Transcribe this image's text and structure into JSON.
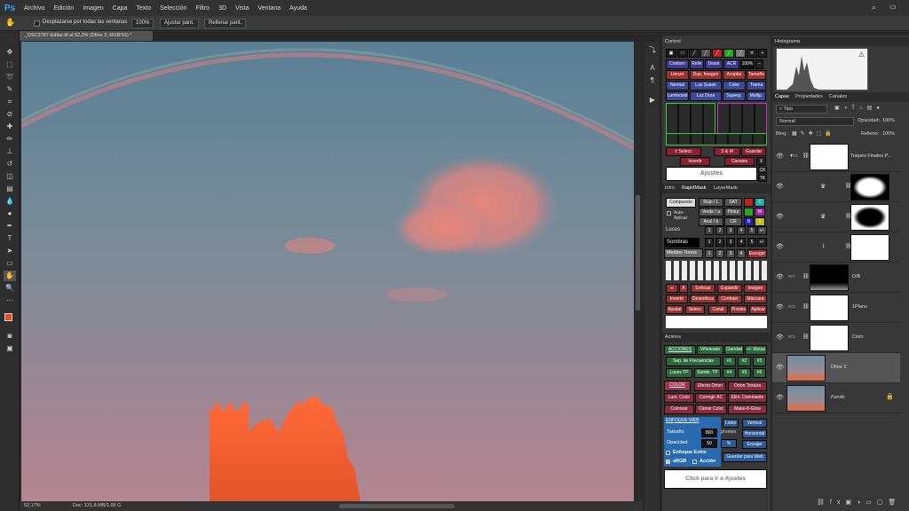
{
  "app": {
    "logo": "Ps"
  },
  "menu": [
    "Archivo",
    "Edición",
    "Imagen",
    "Capa",
    "Texto",
    "Selección",
    "Filtro",
    "3D",
    "Vista",
    "Ventana",
    "Ayuda"
  ],
  "options": {
    "scroll_all": "Desplazarse por todas las ventanas",
    "zoom": "100%",
    "fit": "Ajustar pant.",
    "fill": "Rellenar pant."
  },
  "document": {
    "tab": "_DSC3787-Editar.tif al 52,2% (Dfine 2, RGB/16) *",
    "zoom": "52,17%",
    "doc_info": "Doc: 131,8 MB/1,09 G"
  },
  "control_panel": {
    "title": "Control",
    "row1": [
      "Contorn",
      "Relle",
      "Desnt",
      "ACR",
      "100%"
    ],
    "row2": [
      "Lienzo",
      "Dup. Imagen",
      "Acoplar",
      "Tamaño"
    ],
    "row3": [
      "Normal",
      "Luz Suave",
      "Color",
      "Trama"
    ],
    "row4": [
      "Luminosid",
      "Luz Dura",
      "Superp.",
      "Multip."
    ],
    "row_sel": [
      "± Selecc",
      "S & M",
      "Guardar"
    ],
    "row_inv": [
      "Invertir",
      "Canales",
      "X"
    ],
    "ajustes": "Ajustes",
    "ck": "CK",
    "tk": "TK"
  },
  "rapidmask": {
    "tabs": [
      "Intro",
      "RapidMask",
      "LayerMask"
    ],
    "compuesto": "Compuesto",
    "auto_aplicar": "Auto-Aplicar",
    "col_a": [
      "Rojo / L",
      "Verde / a",
      "Azul / b"
    ],
    "col_b": [
      "SAT",
      "Pintur",
      "CR"
    ],
    "rgby": [
      "C",
      "M",
      "B",
      "Y"
    ],
    "luces": "Luces",
    "sombras": "Sombras",
    "medios": "Medios Tonos",
    "escoger": "Escoger",
    "nums": [
      "1",
      "2",
      "3",
      "4",
      "5",
      "+/-"
    ],
    "actions1": [
      "A",
      "Enfocar",
      "Expandir",
      "Imagen"
    ],
    "actions2": [
      "Invertir",
      "Desenfoca",
      "Contraer",
      "Máscara"
    ],
    "actions3": [
      "Ajustar",
      "Selecc",
      "Canal",
      "Pixeles",
      "Aplicar"
    ]
  },
  "actions": {
    "title": "Actions",
    "acciones": "ACCIONES",
    "a1": [
      "Viñeteado",
      "Claridad",
      "+/- Motas"
    ],
    "a2": [
      "Sep. de Frecuencias",
      "#1",
      "#2",
      "#3"
    ],
    "a3": [
      "Luces TP",
      "Sombr. TP",
      "#4",
      "#5",
      "#6"
    ],
    "color": "COLOR",
    "c1": [
      "Efecto Orton",
      "Orton Textura"
    ],
    "c2": [
      "Lum. Color",
      "Corregir AC",
      "Elim. Dominante"
    ],
    "c3": [
      "Colorear",
      "Clonar Color",
      "Make-It-Glow"
    ],
    "web_title": "ENFOQUE WEB",
    "lotes": "Lotes",
    "vertical": "Vertical",
    "horizontal": "Horizontal",
    "encajar": "Encajar",
    "tamano": "Tamaño",
    "tamano_val": "800",
    "pixeles": "píxeles",
    "opacidad": "Opacidad",
    "opacidad_val": "50",
    "pct": "%",
    "enfoque_extra": "Enfoque Extra",
    "srgb": "sRGB",
    "accion": "Acción",
    "guardar_web": "Guardar para Web",
    "click_ajustes": "Click para ir a Ajustes"
  },
  "histogram": {
    "title": "Histograma"
  },
  "layers": {
    "tabs": [
      "Capas",
      "Propiedades",
      "Canales"
    ],
    "filter": "Tipo",
    "blend": "Normal",
    "opacity_label": "Opacidad:",
    "opacity": "100%",
    "lock_label": "Bloq.:",
    "fill_label": "Relleno:",
    "fill": "100%",
    "items": [
      {
        "name": "Toques Finales P..."
      },
      {
        "name": ""
      },
      {
        "name": ""
      },
      {
        "name": ""
      },
      {
        "name": "D/B"
      },
      {
        "name": "1Plano"
      },
      {
        "name": "Cielo"
      },
      {
        "name": "Dfine 2"
      },
      {
        "name": "Fondo"
      }
    ]
  }
}
